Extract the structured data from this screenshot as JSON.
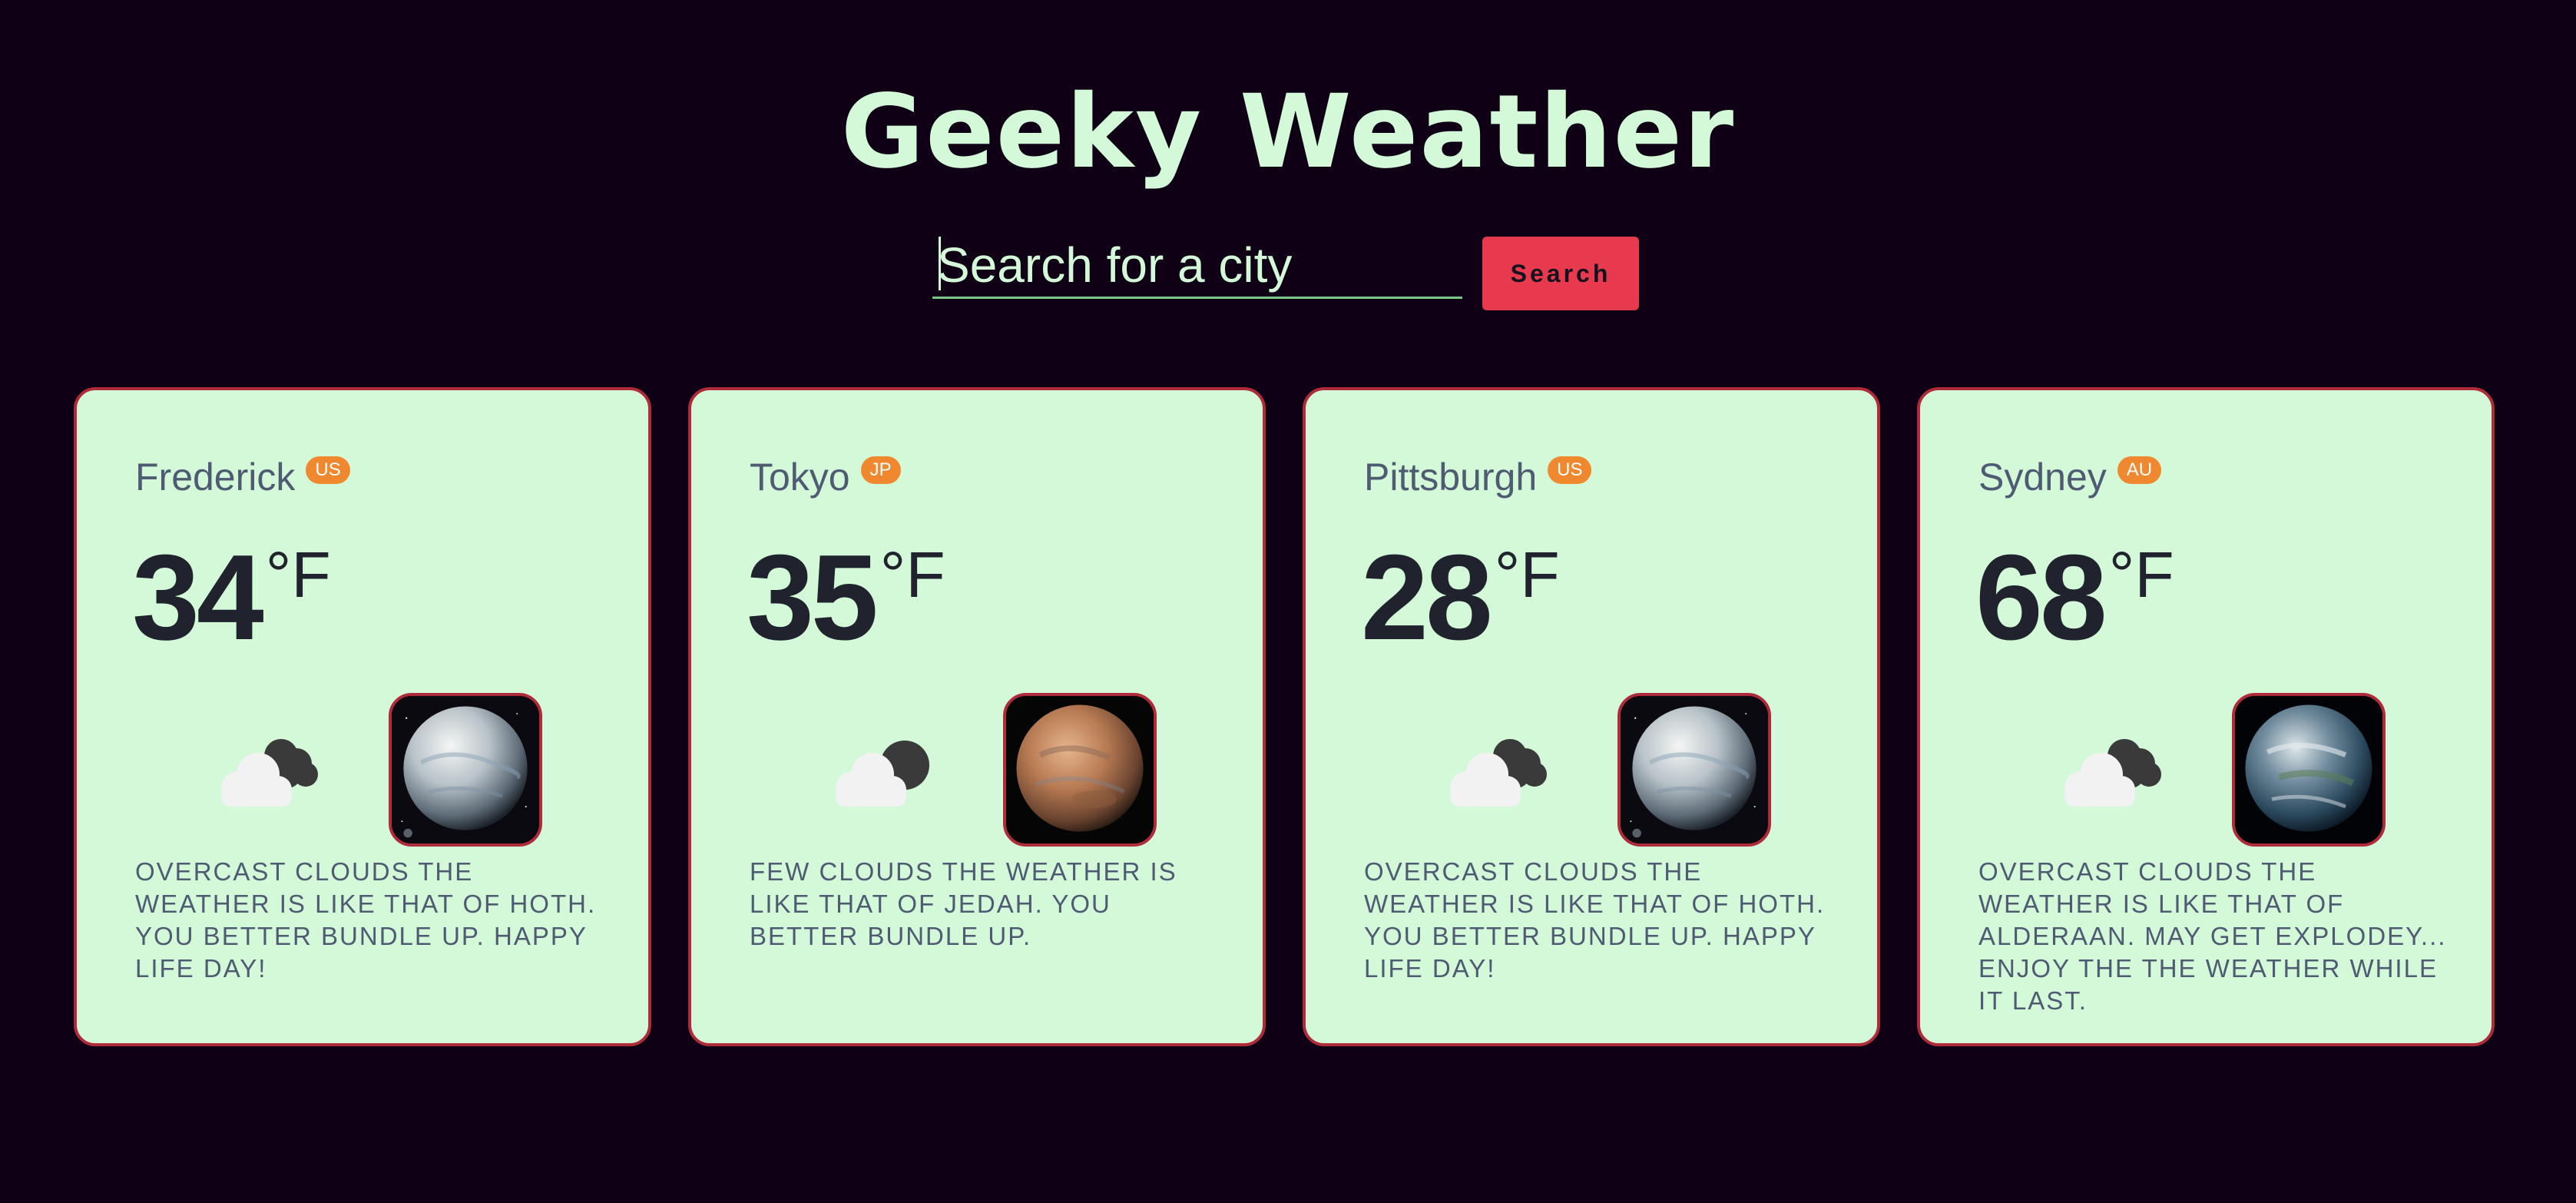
{
  "app": {
    "title": "Geeky Weather"
  },
  "search": {
    "placeholder": "Search for a city",
    "button_label": "Search"
  },
  "theme": {
    "background": "#0f0015",
    "accent_green": "#d3f9d8",
    "accent_red": "#e83a4e",
    "badge_orange": "#f0882f"
  },
  "cards": [
    {
      "city": "Frederick",
      "country": "US",
      "temp": "34",
      "unit": "°F",
      "weather_icon": "cloud-night-icon",
      "planet": "Hoth",
      "description": "OVERCAST CLOUDS THE WEATHER IS LIKE THAT OF HOTH. YOU BETTER BUNDLE UP. HAPPY LIFE DAY!"
    },
    {
      "city": "Tokyo",
      "country": "JP",
      "temp": "35",
      "unit": "°F",
      "weather_icon": "cloud-moon-icon",
      "planet": "Jedah",
      "description": "FEW CLOUDS THE WEATHER IS LIKE THAT OF JEDAH. YOU BETTER BUNDLE UP."
    },
    {
      "city": "Pittsburgh",
      "country": "US",
      "temp": "28",
      "unit": "°F",
      "weather_icon": "cloud-night-icon",
      "planet": "Hoth",
      "description": "OVERCAST CLOUDS THE WEATHER IS LIKE THAT OF HOTH. YOU BETTER BUNDLE UP. HAPPY LIFE DAY!"
    },
    {
      "city": "Sydney",
      "country": "AU",
      "temp": "68",
      "unit": "°F",
      "weather_icon": "cloud-night-icon",
      "planet": "Alderaan",
      "description": "OVERCAST CLOUDS THE WEATHER IS LIKE THAT OF ALDERAAN. MAY GET EXPLODEY... ENJOY THE THE WEATHER WHILE IT LAST."
    }
  ]
}
